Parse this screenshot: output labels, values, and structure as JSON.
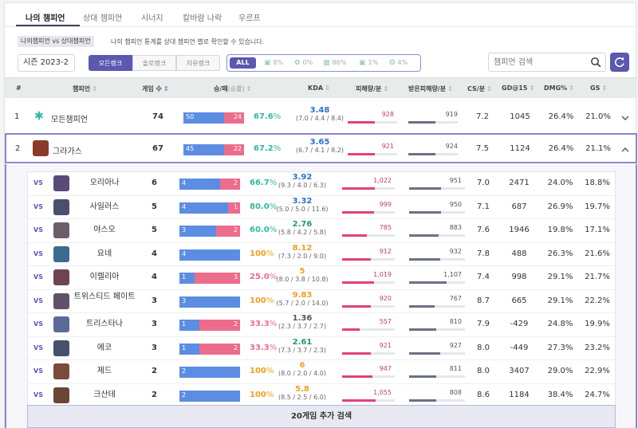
{
  "tabs": [
    "나의 챔피언",
    "상대 챔피언",
    "시너지",
    "칼바람 나락",
    "우르프"
  ],
  "description": {
    "chip": "나의챔피언 vs 상대챔피언",
    "text": "나의 챔피언 통계를 상대 챔피언 별로 확인할 수 있습니다."
  },
  "season": "시즌 2023-2",
  "queues": [
    "모든랭크",
    "솔로랭크",
    "자유랭크"
  ],
  "positions": {
    "all": "ALL",
    "items": [
      {
        "icon": "top-lane-icon",
        "pct": "8%"
      },
      {
        "icon": "jungle-icon",
        "pct": "0%"
      },
      {
        "icon": "mid-lane-icon",
        "pct": "86%"
      },
      {
        "icon": "bot-lane-icon",
        "pct": "1%"
      },
      {
        "icon": "support-icon",
        "pct": "4%"
      }
    ]
  },
  "search": {
    "placeholder": "챔피언 검색"
  },
  "headers": {
    "num": "#",
    "champion": "챔피언",
    "games": "게임 수",
    "winloss": "승/패",
    "winloss_sub": "(승률)",
    "kda": "KDA",
    "dmg": "피해량/분",
    "taken": "받은피해량/분",
    "cs": "CS/분",
    "gd": "GD@15",
    "dmgpct": "DMG%",
    "gs": "GS"
  },
  "main_rows": [
    {
      "idx": "1",
      "name": "모든챔피언",
      "games": "74",
      "wins": "50",
      "losses": "24",
      "win_frac": 0.676,
      "winrate_num": "67.6",
      "winrate_pct": "%",
      "kda": "3.48",
      "kda_detail": "(7.0 / 4.4 / 8.4)",
      "dmg": "928",
      "dmg_frac": 0.55,
      "taken": "919",
      "taken_frac": 0.55,
      "cs": "7.2",
      "gd": "1045",
      "dmgpct": "26.4%",
      "gs": "21.0%"
    },
    {
      "idx": "2",
      "name": "그라가스",
      "games": "67",
      "wins": "45",
      "losses": "22",
      "win_frac": 0.672,
      "winrate_num": "67.2",
      "winrate_pct": "%",
      "kda": "3.65",
      "kda_detail": "(6.7 / 4.1 / 8.2)",
      "dmg": "921",
      "dmg_frac": 0.55,
      "taken": "924",
      "taken_frac": 0.55,
      "cs": "7.5",
      "gd": "1124",
      "dmgpct": "26.4%",
      "gs": "21.1%"
    }
  ],
  "vs_label": "VS",
  "sub_rows": [
    {
      "name": "오리아나",
      "games": "6",
      "wins": "4",
      "losses": "2",
      "win_frac": 0.667,
      "winrate_num": "66.7",
      "winrate_pct": "%",
      "kda": "3.92",
      "kda_detail": "(9.3 / 4.0 / 6.3)",
      "dmg": "1,022",
      "dmg_frac": 0.62,
      "taken": "951",
      "taken_frac": 0.57,
      "cs": "7.0",
      "gd": "2471",
      "dmgpct": "24.0%",
      "gs": "18.8%",
      "color": "#5a4a7a"
    },
    {
      "name": "사일러스",
      "games": "5",
      "wins": "4",
      "losses": "1",
      "win_frac": 0.8,
      "winrate_num": "80.0",
      "winrate_pct": "%",
      "kda": "3.32",
      "kda_detail": "(5.0 / 5.0 / 11.6)",
      "dmg": "999",
      "dmg_frac": 0.6,
      "taken": "950",
      "taken_frac": 0.57,
      "cs": "7.1",
      "gd": "687",
      "dmgpct": "26.9%",
      "gs": "19.7%",
      "color": "#4a4f6e"
    },
    {
      "name": "야스오",
      "games": "5",
      "wins": "3",
      "losses": "2",
      "win_frac": 0.6,
      "winrate_num": "60.0",
      "winrate_pct": "%",
      "kda": "2.76",
      "kda_detail": "(5.8 / 4.2 / 5.8)",
      "dmg": "785",
      "dmg_frac": 0.47,
      "taken": "883",
      "taken_frac": 0.53,
      "cs": "7.6",
      "gd": "1946",
      "dmgpct": "19.8%",
      "gs": "17.1%",
      "color": "#6b5f6a"
    },
    {
      "name": "요네",
      "games": "4",
      "wins": "4",
      "losses": "0",
      "win_frac": 1.0,
      "winrate_num": "100",
      "winrate_pct": "%",
      "kda": "8.12",
      "kda_detail": "(7.3 / 2.0 / 9.0)",
      "dmg": "912",
      "dmg_frac": 0.55,
      "taken": "932",
      "taken_frac": 0.56,
      "cs": "7.8",
      "gd": "488",
      "dmgpct": "26.3%",
      "gs": "21.6%",
      "color": "#3b6a8f"
    },
    {
      "name": "이렐리아",
      "games": "4",
      "wins": "1",
      "losses": "3",
      "win_frac": 0.25,
      "winrate_num": "25.0",
      "winrate_pct": "%",
      "kda": "5",
      "kda_detail": "(8.0 / 3.8 / 10.8)",
      "dmg": "1,019",
      "dmg_frac": 0.61,
      "taken": "1,107",
      "taken_frac": 0.67,
      "cs": "7.4",
      "gd": "998",
      "dmgpct": "29.1%",
      "gs": "21.7%",
      "color": "#6e4455"
    },
    {
      "name": "트위스티드 페이트",
      "games": "3",
      "wins": "3",
      "losses": "0",
      "win_frac": 1.0,
      "winrate_num": "100",
      "winrate_pct": "%",
      "kda": "9.83",
      "kda_detail": "(5.7 / 2.0 / 14.0)",
      "dmg": "920",
      "dmg_frac": 0.55,
      "taken": "767",
      "taken_frac": 0.46,
      "cs": "8.7",
      "gd": "665",
      "dmgpct": "29.1%",
      "gs": "22.2%",
      "color": "#5d5268"
    },
    {
      "name": "트리스타나",
      "games": "3",
      "wins": "1",
      "losses": "2",
      "win_frac": 0.333,
      "winrate_num": "33.3",
      "winrate_pct": "%",
      "kda": "1.36",
      "kda_detail": "(2.3 / 3.7 / 2.7)",
      "dmg": "557",
      "dmg_frac": 0.33,
      "taken": "810",
      "taken_frac": 0.49,
      "cs": "7.9",
      "gd": "-429",
      "dmgpct": "24.8%",
      "gs": "19.9%",
      "color": "#5b6a9a"
    },
    {
      "name": "에코",
      "games": "3",
      "wins": "1",
      "losses": "2",
      "win_frac": 0.333,
      "winrate_num": "33.3",
      "winrate_pct": "%",
      "kda": "2.61",
      "kda_detail": "(7.3 / 3.7 / 2.3)",
      "dmg": "921",
      "dmg_frac": 0.55,
      "taken": "927",
      "taken_frac": 0.56,
      "cs": "8.0",
      "gd": "-449",
      "dmgpct": "27.3%",
      "gs": "23.2%",
      "color": "#45506a"
    },
    {
      "name": "제드",
      "games": "2",
      "wins": "2",
      "losses": "0",
      "win_frac": 1.0,
      "winrate_num": "100",
      "winrate_pct": "%",
      "kda": "6",
      "kda_detail": "(8.0 / 2.0 / 4.0)",
      "dmg": "947",
      "dmg_frac": 0.57,
      "taken": "811",
      "taken_frac": 0.49,
      "cs": "8.0",
      "gd": "3407",
      "dmgpct": "29.0%",
      "gs": "22.9%",
      "color": "#7a4a3a"
    },
    {
      "name": "크산테",
      "games": "2",
      "wins": "2",
      "losses": "0",
      "win_frac": 1.0,
      "winrate_num": "100",
      "winrate_pct": "%",
      "kda": "5.8",
      "kda_detail": "(8.5 / 2.5 / 6.0)",
      "dmg": "1,055",
      "dmg_frac": 0.63,
      "taken": "808",
      "taken_frac": 0.49,
      "cs": "8.6",
      "gd": "1184",
      "dmgpct": "38.4%",
      "gs": "24.7%",
      "color": "#6a4636"
    }
  ],
  "more_button": "20게임 추가 검색",
  "colors": {
    "accent": "#5b58b0",
    "win": "#5c8de2",
    "loss": "#ec6d8b",
    "teal": "#2eb8a0",
    "orange": "#f0a020",
    "blue": "#2f6fd0",
    "green": "#1f9a6a"
  }
}
